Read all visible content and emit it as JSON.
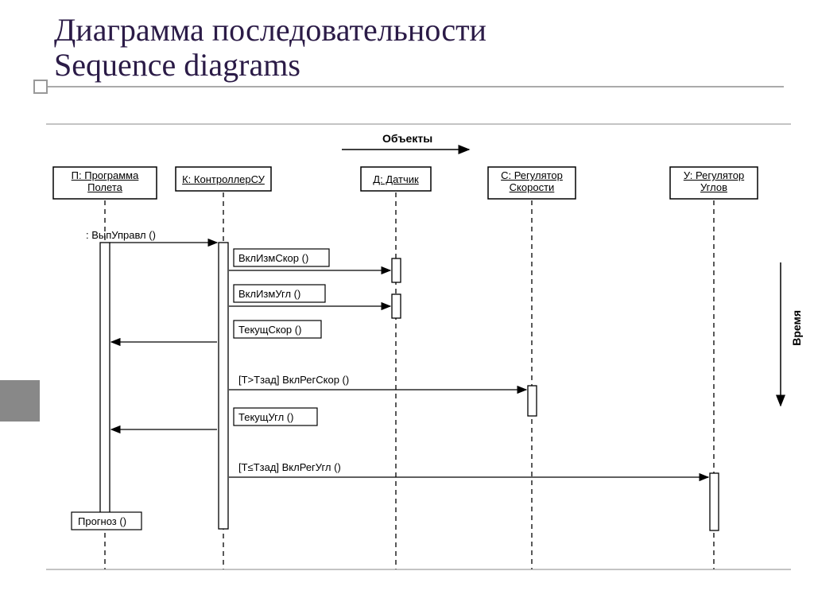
{
  "title": {
    "line1": "Диаграмма последовательности",
    "line2": "Sequence diagrams"
  },
  "labels": {
    "objects": "Объекты",
    "time": "Время"
  },
  "lifelines": [
    {
      "id": "P",
      "label": "П: Программа Полета"
    },
    {
      "id": "K",
      "label": "К: КонтроллерСУ"
    },
    {
      "id": "D",
      "label": "Д: Датчик"
    },
    {
      "id": "C",
      "label": "С: Регулятор Скорости"
    },
    {
      "id": "U",
      "label": "У: Регулятор Углов"
    }
  ],
  "messages": [
    {
      "from": "P",
      "to": "K",
      "text": ": ВыпУправл ()"
    },
    {
      "from": "K",
      "to": "D",
      "text": "ВклИзмСкор ()"
    },
    {
      "from": "K",
      "to": "D",
      "text": "ВклИзмУгл ()"
    },
    {
      "from": "K",
      "to": "P",
      "text": "ТекущСкор ()"
    },
    {
      "from": "K",
      "to": "C",
      "text": "[T>Tзад] ВклРегСкор ()"
    },
    {
      "from": "K",
      "to": "P",
      "text": "ТекущУгл ()"
    },
    {
      "from": "K",
      "to": "U",
      "text": "[T≤Tзад] ВклРегУгл ()"
    },
    {
      "from": "P",
      "to": "P",
      "text": "Прогноз ()"
    }
  ]
}
